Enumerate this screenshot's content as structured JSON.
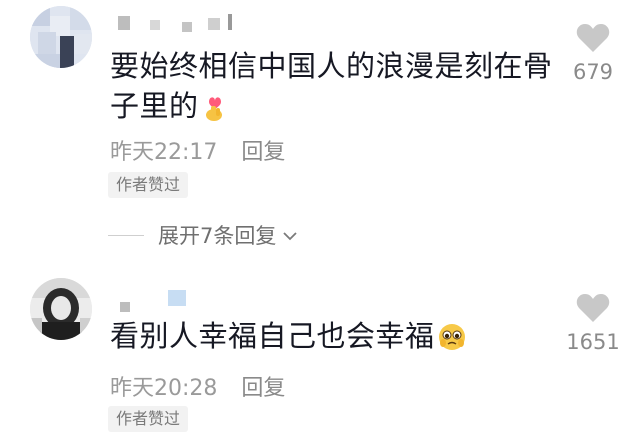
{
  "comments": [
    {
      "text": "要始终相信中国人的浪漫是刻在骨子里的",
      "emoji": "finger-heart-icon",
      "time": "昨天22:17",
      "reply_label": "回复",
      "author_badge": "作者赞过",
      "expand_label": "展开7条回复",
      "like_count": "679"
    },
    {
      "text": "看别人幸福自己也会幸福",
      "emoji": "pleading-face-icon",
      "time": "昨天20:28",
      "reply_label": "回复",
      "author_badge": "作者赞过",
      "like_count": "1651"
    }
  ],
  "colors": {
    "primary_text": "#161823",
    "secondary_text": "#9a9a9a",
    "heart": "#c8c8c8",
    "badge_bg": "#f2f2f2"
  }
}
